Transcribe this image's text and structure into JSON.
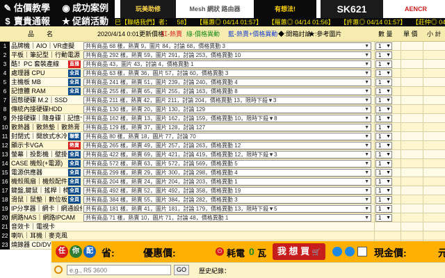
{
  "nav": {
    "items": [
      {
        "label": "估價教學",
        "icon": "edit-icon"
      },
      {
        "label": "成功案例",
        "icon": "camera-icon"
      },
      {
        "label": "賣貴通報",
        "icon": "price-tag-icon"
      },
      {
        "label": "促銷活動",
        "icon": "star-icon"
      }
    ]
  },
  "banners": [
    {
      "text": "玩美助修",
      "bg": "#1a1a1a",
      "fg": "#ffd84a"
    },
    {
      "text": "Mesh 網狀 路由器",
      "bg": "#ffffff",
      "fg": "#555555"
    },
    {
      "text": "有想法!",
      "bg": "#0b0b0b",
      "fg": "#ffd400"
    },
    {
      "text": "SK621",
      "bg": "#1b1b1b",
      "fg": "#ffffff"
    },
    {
      "text": "AENCR",
      "bg": "#ffffff",
      "fg": "#c81d1d"
    }
  ],
  "infostrip": {
    "contact": "巳【聯絡我們】者：",
    "count": "58】",
    "items": [
      "【羅蕙◎ 04/14 01:57】",
      "【羅蕙◎ 04/14 01:56】",
      "【許蕙◎ 04/14 01:57】",
      "【莊仲◎ 04/14 01:28】"
    ]
  },
  "header": {
    "name": "品　　名",
    "updated": "2020/4/14 0:01更新價格",
    "legend1": "紅-熱賣",
    "legend2": "綠-價格異動",
    "legend3": "藍-熱賣+價格異動",
    "legend4": "◆:開箱討論",
    "legend5": "★:參考圖片",
    "qty": "數 量",
    "unit_price": "單 價",
    "subtotal": "小 計"
  },
  "rows": [
    {
      "no": "1",
      "cat": "品牌機｜AIO｜VR虛擬",
      "desc": "共有商品 68 樣，熱賣 9，圖片 84，討論 68，價格異動 3",
      "qty": "1"
    },
    {
      "no": "2",
      "cat": "平板｜筆記型｜行動電源",
      "desc": "共有商品 292 樣，熱賣 59，圖片 291，討論 253，價格異動 10",
      "qty": "1"
    },
    {
      "no": "3",
      "cat": "酷！PC 套裝產線",
      "tag": "直播",
      "tagc": "#d81b1b",
      "desc": "共有商品 43，圖片 43，討論 4，價格異動 1",
      "qty": "1"
    },
    {
      "no": "4",
      "cat": "處理器 CPU",
      "tag": "全頁",
      "tagc": "#0a4b8c",
      "desc": "共有商品 63 樣，熱賣 36，圖片 57，討論 60，價格異動 3",
      "qty": "1"
    },
    {
      "no": "5",
      "cat": "主機板 MB",
      "tag": "全頁",
      "tagc": "#0a4b8c",
      "desc": "共有商品 241 樣，熱賣 51，圖片 239，討論 240，價格異動 4",
      "qty": "1"
    },
    {
      "no": "6",
      "cat": "記憶體 RAM",
      "tag": "全頁",
      "tagc": "#0a4b8c",
      "desc": "共有商品 255 樣，熱賣 65，圖片 255，討論 163，價格異動 8",
      "qty": "1"
    },
    {
      "no": "7",
      "cat": "固態硬碟 M.2｜SSD",
      "desc": "共有商品 211 樣，熱賣 42，圖片 211，討論 204，價格異動 13，限時下殺▼3",
      "qty": "1"
    },
    {
      "no": "8",
      "cat": "傳統內接硬碟HDD",
      "desc": "共有商品 130 樣，熱賣 20，圖片 130，討論 129",
      "qty": "1"
    },
    {
      "no": "9",
      "cat": "外接硬碟｜隨身碟｜記憶卡",
      "desc": "共有商品 162 樣，熱賣 13，圖片 162，討論 159，價格異動 10，限時下殺▼8",
      "qty": "1"
    },
    {
      "no": "10",
      "cat": "散熱器｜散熱墊｜散熱膏",
      "desc": "共有商品 129 樣，熱賣 37，圖片 128，討論 127",
      "qty": "1"
    },
    {
      "no": "11",
      "cat": "封閉式｜開放式水冷",
      "tag": "聯繫",
      "tagc": "#0a4b8c",
      "desc": "共有商品 80 樣，熱賣 18，圖片 77，討論 70",
      "qty": "1"
    },
    {
      "no": "12",
      "cat": "顯示卡VGA",
      "tag": "熱賣",
      "tagc": "#d81b1b",
      "desc": "共有商品 265 樣，熱賣 49，圖片 257，討論 263，價格異動 12",
      "qty": "1"
    },
    {
      "no": "13",
      "cat": "螢幕｜投影機｜壁掛",
      "tag": "全頁",
      "tagc": "#0a4b8c",
      "desc": "共有商品 422 樣，熱賣 69，圖片 421，討論 419，價格異動 12，限時下殺▼3",
      "qty": "1"
    },
    {
      "no": "14",
      "cat": "CASE 機殼(+電源)",
      "tag": "全頁",
      "tagc": "#0a4b8c",
      "desc": "共有商品 572 樣，熱賣 63，圖片 572，討論 569，價格異動 5",
      "qty": "1"
    },
    {
      "no": "15",
      "cat": "電源供應器",
      "tag": "全頁",
      "tagc": "#0a4b8c",
      "desc": "共有商品 299 樣，熱賣 29，圖片 300，討論 298，價格異動 4",
      "qty": "1"
    },
    {
      "no": "16",
      "cat": "機殼風扇｜機殼配件",
      "tag": "全頁",
      "tagc": "#0a4b8c",
      "desc": "共有商品 204 樣，熱賣 24，圖片 204，討論 203，價格異動 1",
      "qty": "1"
    },
    {
      "no": "17",
      "cat": "鍵盤,鍵鼠｜搖桿｜椅",
      "tag": "全頁",
      "tagc": "#0a4b8c",
      "desc": "共有商品 492 樣，熱賣 52，圖片 492，討論 358，價格異動 19",
      "qty": "1"
    },
    {
      "no": "18",
      "cat": "滑鼠｜鼠墊｜數位板",
      "tag": "全頁",
      "tagc": "#0a4b8c",
      "desc": "共有商品 384 樣，熱賣 55，圖片 384，討論 282，價格異動 3",
      "qty": "1"
    },
    {
      "no": "19",
      "cat": "IP分享器｜網卡｜網通設備",
      "desc": "共有商品 181 樣，熱賣 41，圖片 181，討論 179，價格異動 13，限時下殺▼5",
      "qty": "1"
    },
    {
      "no": "20",
      "cat": "網路NAS｜網路IPCAM",
      "desc": "共有商品 71 樣，熱賣 10，圖片 71，討論 48，價格異動 1",
      "qty": "1"
    },
    {
      "no": "21",
      "cat": "音效卡｜電視卡",
      "desc": "",
      "qty": ""
    },
    {
      "no": "22",
      "cat": "喇叭｜耳機｜麥克風",
      "desc": "",
      "qty": ""
    },
    {
      "no": "23",
      "cat": "燒錄器 CD/DVD",
      "desc": "",
      "qty": ""
    }
  ],
  "bottom": {
    "btn_ren": "任",
    "btn_ni": "你",
    "btn_pei": "配",
    "label_sheng": "省:",
    "label_discount": "優惠價:",
    "power_label": "耗電",
    "power_value": "0",
    "power_unit": "瓦",
    "buy_button": "我 想 買",
    "cash_label": "現金價:",
    "cash_unit": "元",
    "search_placeholder": "e.g., R5 3600",
    "go_button": "GO",
    "history_label": "歷史紀錄："
  },
  "colors": {
    "accent_yellow": "#ffb000",
    "nav_bg": "#0b0b0b",
    "header_bg": "#f7ecb0"
  }
}
